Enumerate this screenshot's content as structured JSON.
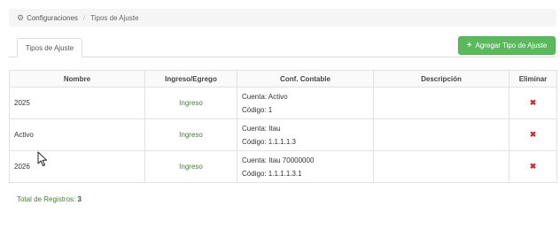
{
  "breadcrumb": {
    "icon": "gears-icon",
    "root": "Configuraciones",
    "separator": "/",
    "current": "Tipos de Ajuste"
  },
  "tab": {
    "label": "Tipos de Ajuste"
  },
  "add_button": {
    "icon": "plus-icon",
    "label": "Agregar Tipo de Ajuste",
    "color": "#5cb85c"
  },
  "table": {
    "headers": [
      "Nombre",
      "Ingreso/Egrego",
      "Conf. Contable",
      "Descripción",
      "Eliminar"
    ],
    "rows": [
      {
        "nombre": "2025",
        "tipo": "Ingreso",
        "cuenta": "Cuenta: Activo",
        "codigo": "Código: 1",
        "descripcion": "",
        "eliminar": "✖"
      },
      {
        "nombre": "Activo",
        "tipo": "Ingreso",
        "cuenta": "Cuenta: Itau",
        "codigo": "Código: 1.1.1.1.3",
        "descripcion": "",
        "eliminar": "✖"
      },
      {
        "nombre": "2026",
        "tipo": "Ingreso",
        "cuenta": "Cuenta: Itau 70000000",
        "codigo": "Código: 1.1.1.1.3.1",
        "descripcion": "",
        "eliminar": "✖"
      }
    ]
  },
  "footer": {
    "total_label": "Total de Registros:",
    "total_value": "3"
  },
  "colors": {
    "accent_green": "#5cb85c",
    "delete_red": "#c9302c",
    "ingreso_text": "#4a7a3a"
  }
}
